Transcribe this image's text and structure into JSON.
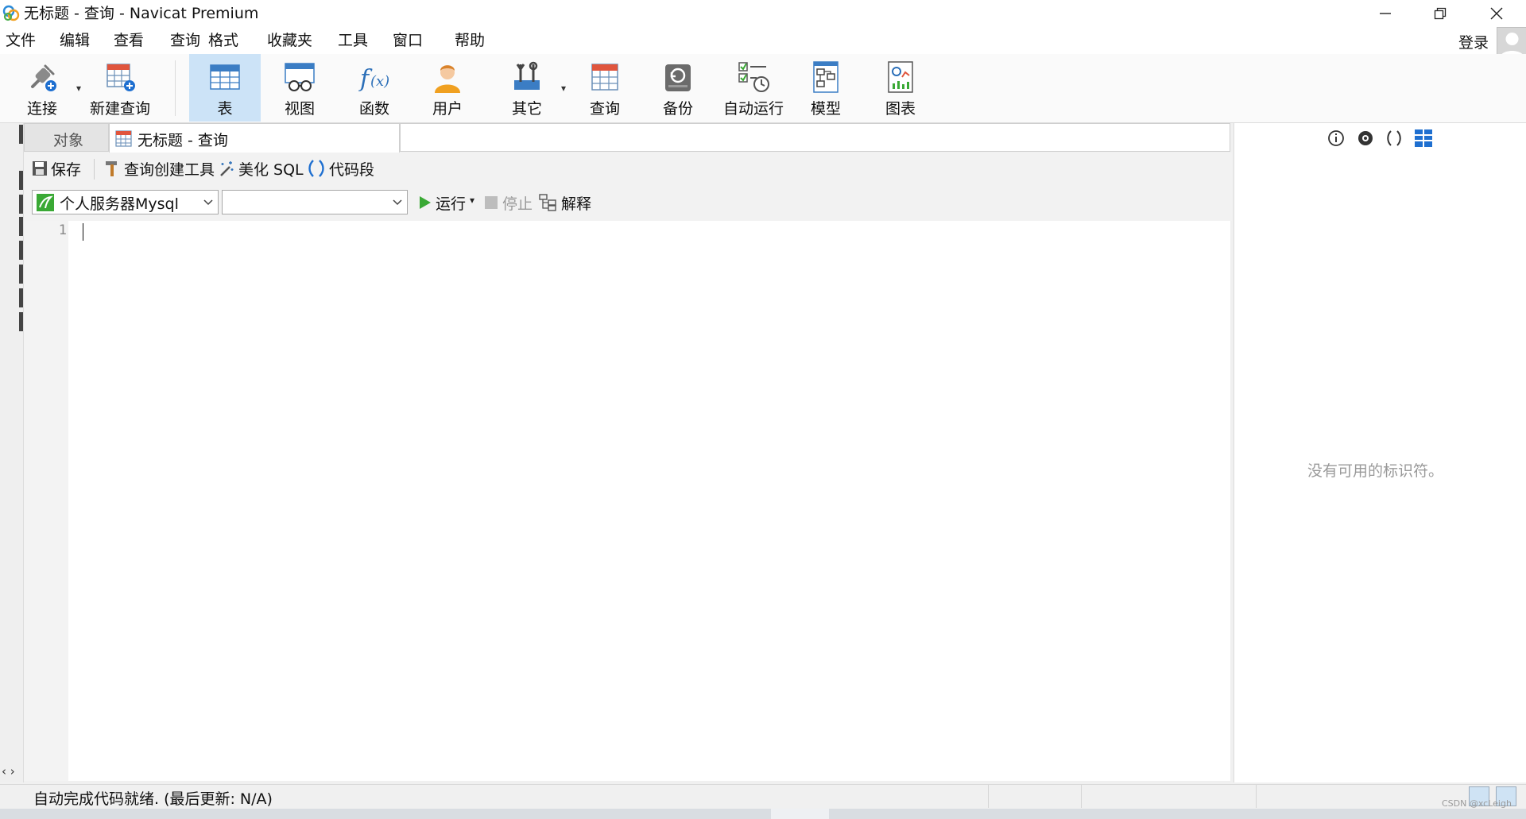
{
  "window": {
    "title": "无标题 - 查询 - Navicat Premium"
  },
  "menu": {
    "items": [
      "文件",
      "编辑",
      "查看",
      "查询",
      "格式",
      "收藏夹",
      "工具",
      "窗口",
      "帮助"
    ],
    "login": "登录"
  },
  "toolbar": {
    "items": [
      {
        "label": "连接",
        "icon": "plug-connect-icon"
      },
      {
        "label": "新建查询",
        "icon": "new-query-icon"
      },
      {
        "label": "表",
        "icon": "table-icon",
        "active": true
      },
      {
        "label": "视图",
        "icon": "view-icon"
      },
      {
        "label": "函数",
        "icon": "function-icon"
      },
      {
        "label": "用户",
        "icon": "user-icon"
      },
      {
        "label": "其它",
        "icon": "tools-icon"
      },
      {
        "label": "查询",
        "icon": "query-icon"
      },
      {
        "label": "备份",
        "icon": "backup-icon"
      },
      {
        "label": "自动运行",
        "icon": "auto-run-icon"
      },
      {
        "label": "模型",
        "icon": "model-icon"
      },
      {
        "label": "图表",
        "icon": "chart-icon"
      }
    ]
  },
  "tabs": {
    "objects": "对象",
    "query": "无标题 - 查询"
  },
  "query_toolbar": {
    "save": "保存",
    "query_builder": "查询创建工具",
    "beautify": "美化 SQL",
    "snippet": "代码段",
    "connection": "个人服务器Mysql",
    "database": "",
    "run": "运行",
    "stop": "停止",
    "explain": "解释"
  },
  "editor": {
    "line_numbers": [
      "1"
    ],
    "content": ""
  },
  "right_panel": {
    "empty_message": "没有可用的标识符。"
  },
  "status": {
    "text": "自动完成代码就绪. (最后更新: N/A)"
  },
  "watermark": "CSDN @xcLeigh",
  "colors": {
    "active_tab_bg": "#cce3f7",
    "run_green": "#3aa935",
    "accent_blue": "#1e6fd0"
  }
}
